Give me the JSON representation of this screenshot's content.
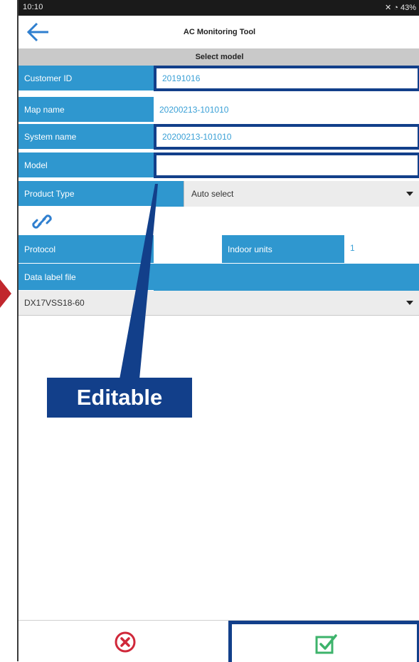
{
  "status_bar": {
    "time": "10:10",
    "right_text": "43%"
  },
  "app": {
    "title": "AC Monitoring Tool",
    "subtitle": "Select model"
  },
  "form": {
    "customer_id": {
      "label": "Customer ID",
      "value": "20191016"
    },
    "map_name": {
      "label": "Map name",
      "value": "20200213-101010"
    },
    "system_name": {
      "label": "System name",
      "value": "20200213-101010"
    },
    "model": {
      "label": "Model",
      "value": ""
    },
    "product_type": {
      "label": "Product Type",
      "selected": "Auto select"
    },
    "protocol": {
      "label": "Protocol",
      "value": ""
    },
    "indoor_units": {
      "label": "Indoor units",
      "value": "1"
    },
    "data_label_file": {
      "label": "Data label file",
      "selected": "DX17VSS18-60"
    }
  },
  "callout": {
    "text": "Editable"
  },
  "colors": {
    "label_bg": "#2f97cf",
    "highlight": "#123f8a",
    "value_text": "#3aa0d6",
    "cancel": "#d0283a",
    "confirm": "#3db36b"
  },
  "icons": {
    "back": "back-arrow-icon",
    "link": "link-icon",
    "cancel": "cancel-circle-icon",
    "confirm": "checkbox-confirm-icon"
  }
}
